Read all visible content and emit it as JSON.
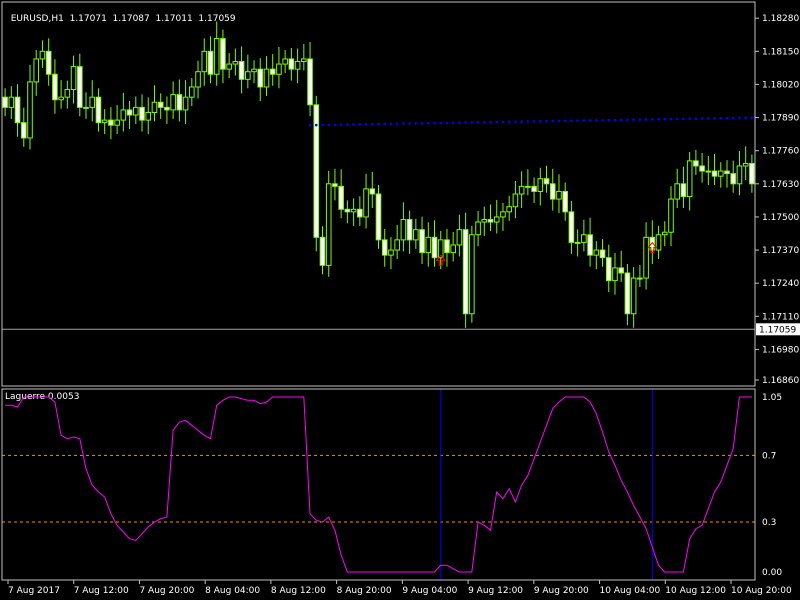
{
  "colors": {
    "background": "#000000",
    "grid": "#c0c0c0",
    "text": "#ffffff",
    "bull_body": "#000000",
    "bull_border": "#7cfc00",
    "bear_body": "#ffffff",
    "bear_border": "#7cfc00",
    "ma_dots": "#0000ff",
    "price_line": "#a0a0a0",
    "laguerre": "#ff00ff",
    "levels": "#ff8c00",
    "vlines": "#0000ff",
    "arrow": "#ff0000"
  },
  "header": {
    "symbol": "EURUSD,H1",
    "ohlc": "1.17071  1.17087  1.17011  1.17059"
  },
  "indicator": {
    "title": "Laguerre 0.0053",
    "axis_labels": [
      "1.05",
      "0.7",
      "0.3",
      "0.00"
    ],
    "levels": [
      0.7,
      0.3
    ]
  },
  "price_axis": {
    "ticks": [
      "1.18280",
      "1.18150",
      "1.18020",
      "1.17890",
      "1.17760",
      "1.17630",
      "1.17500",
      "1.17370",
      "1.17240",
      "1.17110",
      "1.16980",
      "1.16860"
    ],
    "current_price": "1.17059"
  },
  "time_axis": {
    "ticks": [
      "7 Aug 2017",
      "7 Aug 12:00",
      "7 Aug 20:00",
      "8 Aug 04:00",
      "8 Aug 12:00",
      "8 Aug 20:00",
      "9 Aug 04:00",
      "9 Aug 12:00",
      "9 Aug 20:00",
      "10 Aug 04:00",
      "10 Aug 12:00",
      "10 Aug 20:00"
    ]
  },
  "chart_data": [
    {
      "type": "candlestick",
      "symbol": "EURUSD",
      "timeframe": "H1",
      "ylim": [
        1.1686,
        1.1832
      ],
      "closes": [
        1.1793,
        1.1797,
        1.1787,
        1.1781,
        1.1803,
        1.1812,
        1.1815,
        1.1806,
        1.1796,
        1.1797,
        1.18,
        1.1809,
        1.1793,
        1.1793,
        1.1797,
        1.1787,
        1.1788,
        1.1786,
        1.1788,
        1.1792,
        1.179,
        1.1793,
        1.1788,
        1.1791,
        1.1795,
        1.1793,
        1.1792,
        1.1798,
        1.1792,
        1.1797,
        1.1801,
        1.1807,
        1.1815,
        1.1806,
        1.182,
        1.1808,
        1.181,
        1.1811,
        1.1804,
        1.1807,
        1.1808,
        1.1801,
        1.1808,
        1.1806,
        1.181,
        1.1812,
        1.1808,
        1.1811,
        1.1812,
        1.1794,
        1.1742,
        1.1731,
        1.1763,
        1.1762,
        1.1753,
        1.1752,
        1.1753,
        1.175,
        1.1761,
        1.1759,
        1.1741,
        1.1735,
        1.1737,
        1.1741,
        1.1749,
        1.1741,
        1.1745,
        1.1736,
        1.1742,
        1.1734,
        1.1741,
        1.1736,
        1.1739,
        1.1745,
        1.1712,
        1.1743,
        1.1748,
        1.1749,
        1.1748,
        1.175,
        1.1752,
        1.1754,
        1.1759,
        1.1762,
        1.1762,
        1.176,
        1.1765,
        1.1763,
        1.1757,
        1.176,
        1.1752,
        1.174,
        1.174,
        1.1743,
        1.1735,
        1.1737,
        1.1734,
        1.1725,
        1.173,
        1.1728,
        1.1712,
        1.1726,
        1.1726,
        1.1742,
        1.1737,
        1.1743,
        1.1744,
        1.1757,
        1.1763,
        1.1758,
        1.1772,
        1.177,
        1.1768,
        1.1768,
        1.1766,
        1.1768,
        1.1767,
        1.1763,
        1.177,
        1.1771,
        1.1763
      ]
    },
    {
      "type": "line",
      "name": "Laguerre 0.0053",
      "ylim": [
        0,
        1.05
      ],
      "values": [
        1.0,
        1.0,
        0.99,
        1.05,
        1.05,
        1.05,
        1.05,
        1.05,
        1.02,
        0.82,
        0.8,
        0.81,
        0.8,
        0.62,
        0.52,
        0.48,
        0.45,
        0.35,
        0.28,
        0.24,
        0.2,
        0.19,
        0.23,
        0.27,
        0.3,
        0.32,
        0.33,
        0.85,
        0.9,
        0.91,
        0.88,
        0.85,
        0.82,
        0.8,
        1.0,
        1.03,
        1.05,
        1.05,
        1.04,
        1.03,
        1.03,
        1.01,
        1.02,
        1.05,
        1.05,
        1.05,
        1.05,
        1.05,
        1.05,
        0.35,
        0.31,
        0.3,
        0.33,
        0.25,
        0.1,
        0.0,
        0.0,
        0.0,
        0.0,
        0.0,
        0.0,
        0.0,
        0.0,
        0.0,
        0.0,
        0.0,
        0.0,
        0.0,
        0.0,
        0.0,
        0.04,
        0.04,
        0.02,
        0.0,
        0.0,
        0.0,
        0.3,
        0.28,
        0.25,
        0.48,
        0.44,
        0.5,
        0.42,
        0.52,
        0.58,
        0.68,
        0.78,
        0.88,
        0.98,
        1.02,
        1.05,
        1.05,
        1.05,
        1.05,
        1.02,
        0.95,
        0.84,
        0.72,
        0.64,
        0.55,
        0.48,
        0.4,
        0.33,
        0.26,
        0.15,
        0.04,
        0.0,
        0.0,
        0.0,
        0.0,
        0.2,
        0.26,
        0.28,
        0.38,
        0.48,
        0.54,
        0.64,
        0.74,
        1.05,
        1.05,
        1.05
      ]
    }
  ]
}
